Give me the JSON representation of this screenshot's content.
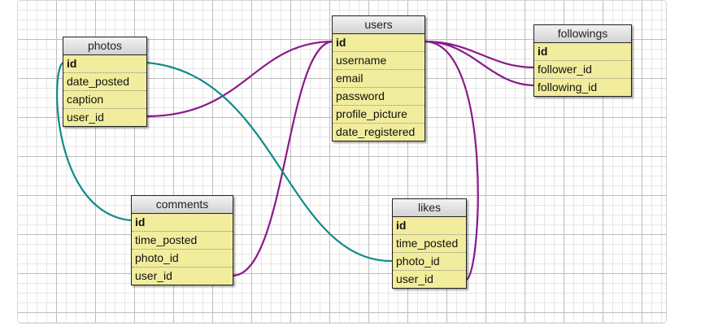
{
  "tables": [
    {
      "key": "photos",
      "title": "photos",
      "fields": [
        {
          "name": "id",
          "pk": true
        },
        {
          "name": "date_posted"
        },
        {
          "name": "caption"
        },
        {
          "name": "user_id"
        }
      ]
    },
    {
      "key": "users",
      "title": "users",
      "fields": [
        {
          "name": "id",
          "pk": true
        },
        {
          "name": "username"
        },
        {
          "name": "email"
        },
        {
          "name": "password"
        },
        {
          "name": "profile_picture"
        },
        {
          "name": "date_registered"
        }
      ]
    },
    {
      "key": "followings",
      "title": "followings",
      "fields": [
        {
          "name": "id",
          "pk": true
        },
        {
          "name": "follower_id"
        },
        {
          "name": "following_id"
        }
      ]
    },
    {
      "key": "comments",
      "title": "comments",
      "fields": [
        {
          "name": "id",
          "pk": true
        },
        {
          "name": "time_posted"
        },
        {
          "name": "photo_id"
        },
        {
          "name": "user_id"
        }
      ]
    },
    {
      "key": "likes",
      "title": "likes",
      "fields": [
        {
          "name": "id",
          "pk": true
        },
        {
          "name": "time_posted"
        },
        {
          "name": "photo_id"
        },
        {
          "name": "user_id"
        }
      ]
    }
  ],
  "relations": [
    {
      "from": "photos.user_id",
      "to": "users.id",
      "color": "#8b1a8b"
    },
    {
      "from": "comments.user_id",
      "to": "users.id",
      "color": "#8b1a8b"
    },
    {
      "from": "likes.user_id",
      "to": "users.id",
      "color": "#8b1a8b"
    },
    {
      "from": "followings.follower_id",
      "to": "users.id",
      "color": "#8b1a8b"
    },
    {
      "from": "followings.following_id",
      "to": "users.id",
      "color": "#8b1a8b"
    },
    {
      "from": "comments.photo_id",
      "to": "photos.id",
      "color": "#138a8a"
    },
    {
      "from": "likes.photo_id",
      "to": "photos.id",
      "color": "#138a8a"
    }
  ]
}
